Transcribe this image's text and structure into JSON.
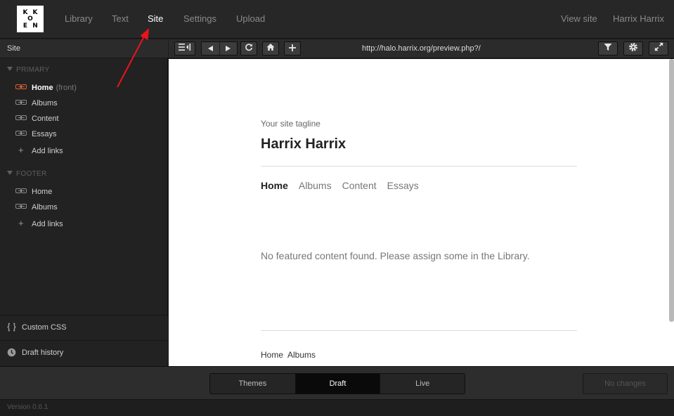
{
  "logo_letters": [
    "K",
    "K",
    "O",
    "E",
    "N"
  ],
  "nav": {
    "library": "Library",
    "text": "Text",
    "site": "Site",
    "settings": "Settings",
    "upload": "Upload",
    "view_site": "View site",
    "user": "Harrix Harrix"
  },
  "sidebar": {
    "title": "Site",
    "primary": {
      "label": "PRIMARY",
      "items": [
        {
          "label": "Home",
          "note": "(front)"
        },
        {
          "label": "Albums"
        },
        {
          "label": "Content"
        },
        {
          "label": "Essays"
        }
      ],
      "add": "Add links"
    },
    "footer": {
      "label": "FOOTER",
      "items": [
        {
          "label": "Home"
        },
        {
          "label": "Albums"
        }
      ],
      "add": "Add links"
    },
    "custom_css": "Custom CSS",
    "draft_history": "Draft history"
  },
  "toolbar": {
    "url": "http://halo.harrix.org/preview.php?/"
  },
  "preview": {
    "tagline": "Your site tagline",
    "title": "Harrix Harrix",
    "nav": [
      "Home",
      "Albums",
      "Content",
      "Essays"
    ],
    "message": "No featured content found. Please assign some in the Library.",
    "footer_links": [
      "Home",
      "Albums"
    ]
  },
  "bottom": {
    "tabs": [
      "Themes",
      "Draft",
      "Live"
    ],
    "active_tab": "Draft",
    "no_changes": "No changes",
    "version": "Version 0.6.1"
  },
  "colors": {
    "accent": "#e0622c",
    "arrow": "#e8141c"
  }
}
